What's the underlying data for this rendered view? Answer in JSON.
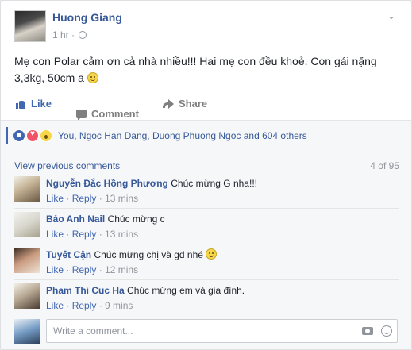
{
  "post": {
    "author": "Huong Giang",
    "time": "1 hr ·",
    "text": "Mẹ con Polar cảm ơn cả nhà nhiều!!! Hai mẹ con đều khoẻ. Con gái nặng 3,3kg, 50cm ạ"
  },
  "actions": {
    "like": "Like",
    "comment": "Comment",
    "share": "Share"
  },
  "reactions": {
    "summary": "You, Ngoc Han Dang, Duong Phuong Ngoc and 604 others"
  },
  "comments_header": {
    "view_previous": "View previous comments",
    "count": "4 of 95"
  },
  "comments": [
    {
      "name": "Nguyễn Đắc Hồng Phương",
      "text": "Chúc mừng G nha!!!",
      "like": "Like",
      "reply": "Reply",
      "time": "13 mins"
    },
    {
      "name": "Bảo Anh Nail",
      "text": "Chúc mừng c",
      "like": "Like",
      "reply": "Reply",
      "time": "13 mins"
    },
    {
      "name": "Tuyết Cận",
      "text": "Chúc mừng chị và gd nhé",
      "like": "Like",
      "reply": "Reply",
      "time": "12 mins"
    },
    {
      "name": "Pham Thi Cuc Ha",
      "text": "Chúc mừng em và gia đình.",
      "like": "Like",
      "reply": "Reply",
      "time": "9 mins"
    }
  ],
  "composer": {
    "placeholder": "Write a comment..."
  },
  "colors": {
    "link": "#365899",
    "accent": "#4267b2",
    "muted": "#90949c",
    "panel": "#f6f7f9"
  }
}
